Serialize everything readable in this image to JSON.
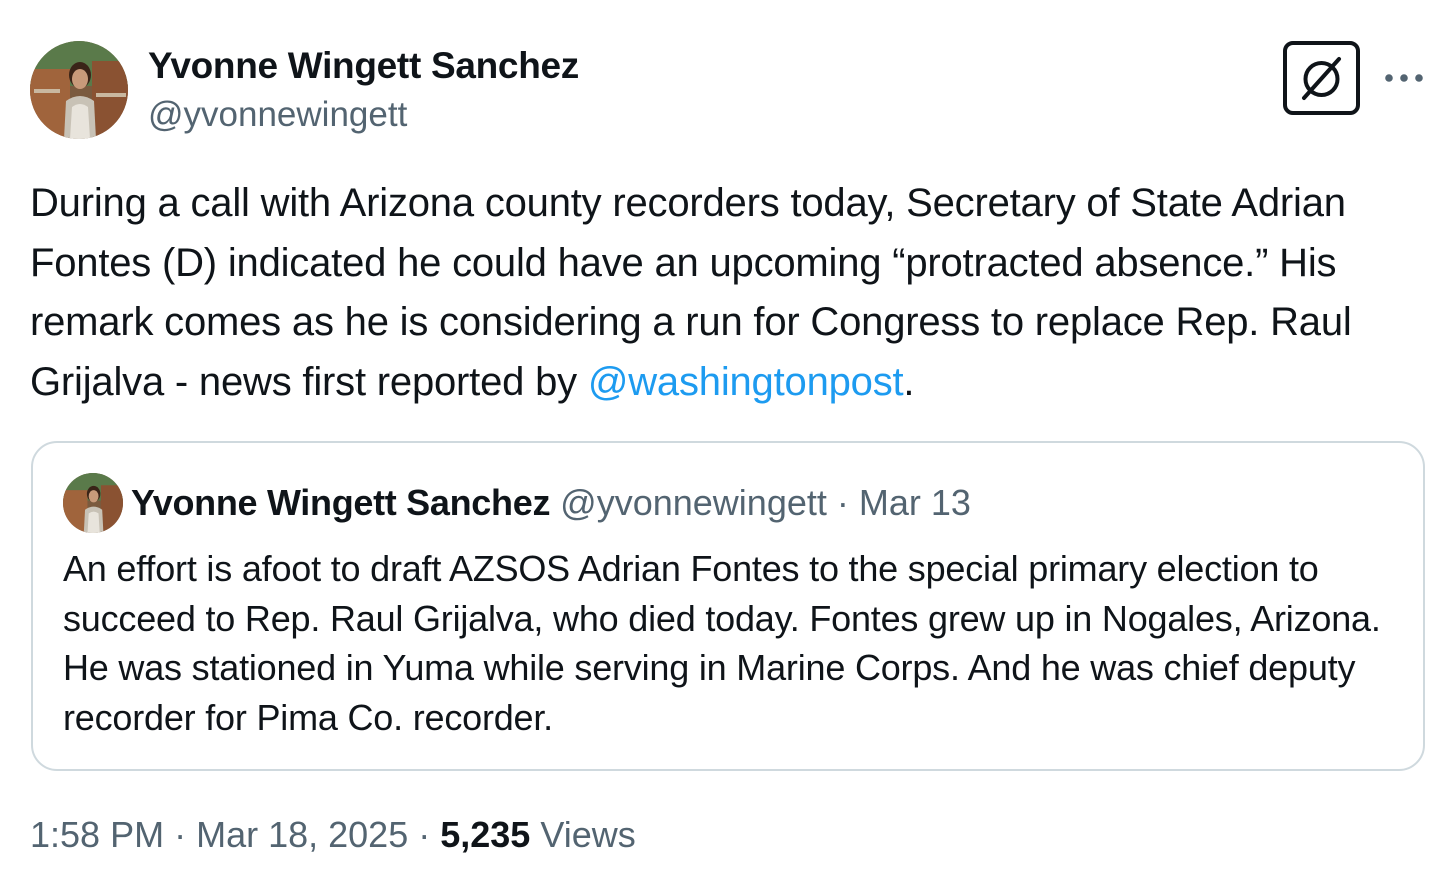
{
  "author": {
    "name": "Yvonne Wingett Sanchez",
    "handle": "@yvonnewingett"
  },
  "tweet": {
    "text_before_mention": "During a call with Arizona county recorders today, Secretary of State Adrian Fontes (D) indicated he could have an upcoming “protracted absence.” His remark comes as he is considering a run for Congress to replace Rep. Raul Grijalva - news first reported by ",
    "mention": "@washingtonpost",
    "text_after_mention": "."
  },
  "quoted_tweet": {
    "author_name": "Yvonne Wingett Sanchez",
    "author_handle": "@yvonnewingett",
    "separator": " · ",
    "date": "Mar 13",
    "text": "An effort is afoot to draft AZSOS Adrian Fontes to the special primary election to succeed to Rep. Raul Grijalva, who died today. Fontes grew up in Nogales, Arizona. He was stationed in Yuma while serving in Marine Corps. And he was chief deputy recorder for Pima Co. recorder."
  },
  "meta": {
    "time": "1:58 PM",
    "separator": " · ",
    "date": "Mar 18, 2025",
    "views_count": "5,235",
    "views_label": "Views"
  },
  "icons": {
    "grok": "grok-icon",
    "more": "more-dots-icon"
  },
  "colors": {
    "text": "#0f1419",
    "secondary": "#536471",
    "link": "#1d9bf0",
    "border": "#cfd9de"
  }
}
